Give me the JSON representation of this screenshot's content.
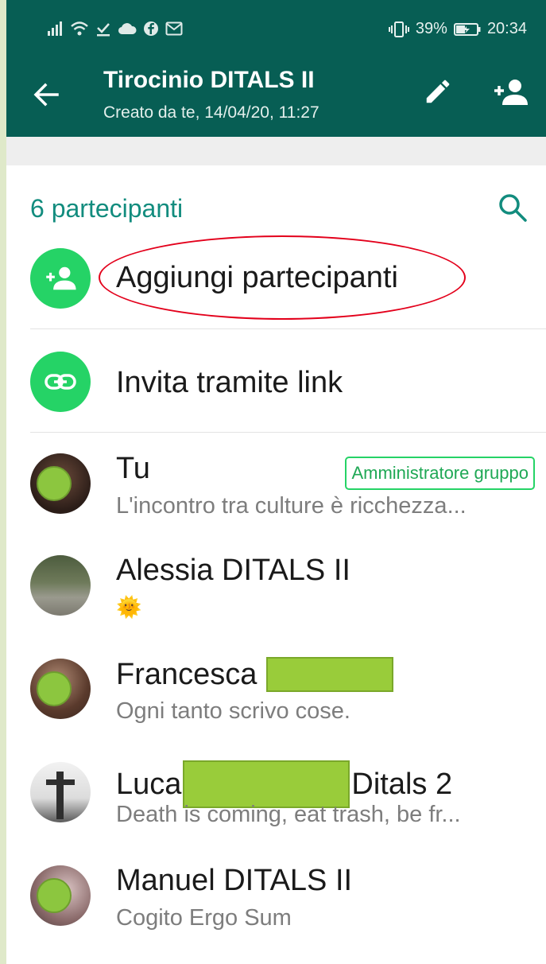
{
  "status_bar": {
    "battery": "39%",
    "time": "20:34",
    "left_icons": [
      "signal-icon",
      "wifi-icon",
      "download-done-icon",
      "cloud-icon",
      "facebook-icon",
      "gmail-icon"
    ],
    "right_icons": [
      "vibrate-icon",
      "battery-icon"
    ]
  },
  "header": {
    "title": "Tirocinio DITALS II",
    "subtitle": "Creato da te, 14/04/20, 11:27",
    "back_icon": "arrow-back-icon",
    "edit_icon": "pencil-icon",
    "add_icon": "person-add-icon"
  },
  "participants": {
    "count_label": "6 partecipanti",
    "search_icon": "search-icon",
    "actions": [
      {
        "label": "Aggiungi partecipanti",
        "icon": "person-add-icon"
      },
      {
        "label": "Invita tramite link",
        "icon": "link-icon"
      }
    ],
    "members": [
      {
        "name": "Tu",
        "about": "L'incontro tra culture è ricchezza...",
        "badge": "Amministratore gruppo"
      },
      {
        "name": "Alessia DITALS II",
        "about": "🌞"
      },
      {
        "name": "Francesca",
        "about": "Ogni tanto scrivo cose."
      },
      {
        "name": "Luca",
        "name_suffix": "Ditals 2",
        "about": "Death is coming, eat trash, be fr..."
      },
      {
        "name": "Manuel DITALS II",
        "about": "Cogito Ergo Sum"
      }
    ]
  },
  "colors": {
    "header": "#075e54",
    "accent": "#128c7e",
    "action_green": "#25d366",
    "highlight": "#e3001b",
    "redaction": "#99cc3a"
  }
}
